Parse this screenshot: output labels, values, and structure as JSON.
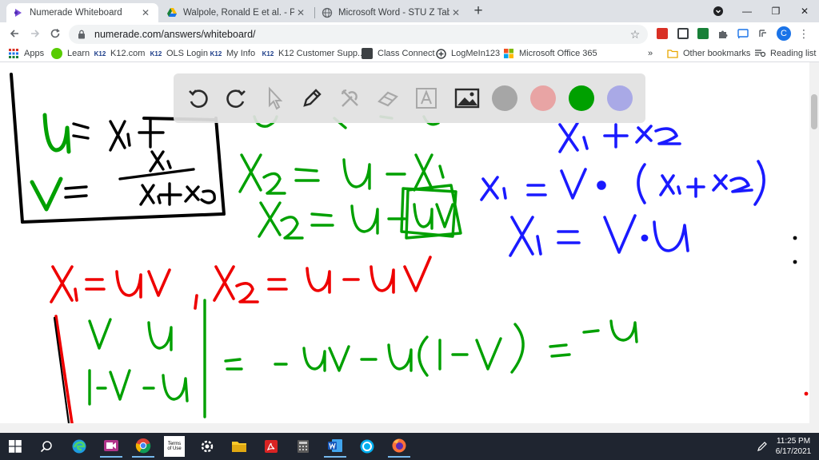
{
  "browser": {
    "tabs": [
      {
        "title": "Numerade Whiteboard",
        "favicon": "numerade-icon",
        "active": true
      },
      {
        "title": "Walpole, Ronald E et al. - Probab",
        "favicon": "google-drive-icon",
        "active": false
      },
      {
        "title": "Microsoft Word - STU Z Table.do",
        "favicon": "globe-icon",
        "active": false
      }
    ],
    "new_tab_label": "+",
    "window_controls": {
      "collapse": "⌄",
      "minimize": "—",
      "restore": "❐",
      "close": "✕"
    },
    "url": "numerade.com/answers/whiteboard/",
    "profile_initial": "C",
    "extension_colors": [
      "#d93025",
      "#3c4043",
      "#188038",
      "#3c4043",
      "#1a73e8"
    ]
  },
  "bookmarks": {
    "apps": "Apps",
    "items": [
      {
        "label": "Learn",
        "icon": "duolingo-icon",
        "badge": "",
        "color": "#58cc02"
      },
      {
        "label": "K12.com",
        "icon": "k12-icon",
        "badge": "K12",
        "color": "#1d3e8a"
      },
      {
        "label": "OLS Login",
        "icon": "k12-icon",
        "badge": "K12",
        "color": "#1d3e8a"
      },
      {
        "label": "My Info",
        "icon": "k12-icon",
        "badge": "K12",
        "color": "#1d3e8a"
      },
      {
        "label": "K12 Customer Supp...",
        "icon": "k12-icon",
        "badge": "K12",
        "color": "#1d3e8a"
      },
      {
        "label": "Class Connect",
        "icon": "class-connect-icon",
        "badge": "",
        "color": "#3c4043"
      },
      {
        "label": "LogMeIn123",
        "icon": "logmein-icon",
        "badge": "",
        "color": "#3c4043"
      },
      {
        "label": "Microsoft Office 365",
        "icon": "office-icon",
        "badge": "",
        "color": "#d83b01"
      }
    ],
    "overflow": "»",
    "other_bookmarks": "Other bookmarks",
    "reading_list": "Reading list"
  },
  "whiteboard": {
    "tools": [
      "undo-icon",
      "redo-icon",
      "pointer-icon",
      "pen-icon",
      "tools-icon",
      "eraser-icon",
      "text-icon",
      "image-icon"
    ],
    "colors": [
      {
        "name": "gray",
        "hex": "#a6a6a6"
      },
      {
        "name": "pink",
        "hex": "#e8a4a4"
      },
      {
        "name": "green",
        "hex": "#00a000"
      },
      {
        "name": "lavender",
        "hex": "#a9a9e6"
      }
    ],
    "ink_colors": {
      "black": "#000000",
      "green": "#00a000",
      "blue": "#1a1aff",
      "red": "#ee0000"
    }
  },
  "taskbar": {
    "icons": [
      "windows-icon",
      "search-icon",
      "edge-icon",
      "zoom-icon",
      "chrome-icon",
      "terms-of-use-icon",
      "settings-icon",
      "file-explorer-icon",
      "acrobat-icon",
      "calculator-icon",
      "word-icon",
      "skype-icon",
      "firefox-icon"
    ],
    "terms_label": "Terms of Use",
    "time": "11:25 PM",
    "date": "6/17/2021"
  }
}
